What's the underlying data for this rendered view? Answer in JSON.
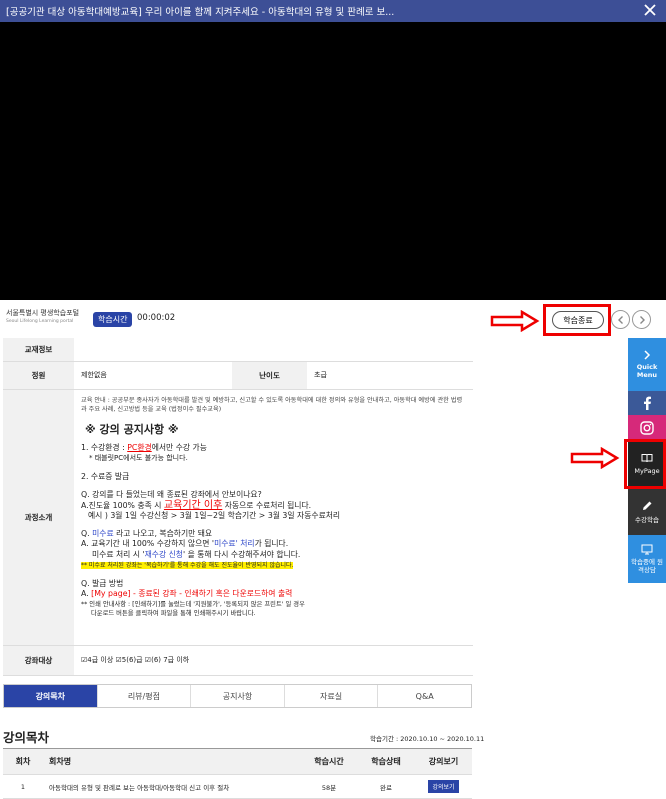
{
  "window": {
    "title": "[공공기관 대상 아동학대예방교육] 우리 아이를 함께 지켜주세요 - 아동학대의 유형 및 판례로 보..."
  },
  "toolbar": {
    "logo_korean": "서울특별시 평생학습포털",
    "logo_english": "Seoul Lifelong Learning portal",
    "timer_label": "학습시간",
    "timer_value": "00:00:02",
    "end_label": "학습종료"
  },
  "info": {
    "material_label": "교재정보",
    "capacity_label": "정원",
    "capacity_value": "제한없음",
    "difficulty_label": "난이도",
    "difficulty_value": "초급",
    "intro_label": "과정소개",
    "intro_text": "교육 안내 : 공공부문 종사자가 아동학대를 발견 및 예방하고, 신고할 수 있도록 아동학대에 대한 정의와 유형을 안내하고, 아동학대 예방에 관한 법령과 주요 사례, 신고방법 등을 교육 (법정이수 필수교육)",
    "notice_title": "※ 강의 공지사항 ※",
    "l1a": "1. 수강환경 : ",
    "l1b": "PC환경",
    "l1c": "에서만 수강 가능",
    "l1d": "* 태블릿PC에서도 불가능 합니다.",
    "l2": "2. 수료증 발급",
    "q1": "Q. 강의를 다 들었는데 왜 종료된 강좌에서 안보이나요?",
    "a1a": "A.진도율 100% 충족 시 ",
    "a1b": "교육기간 이후",
    "a1c": " 자동으로 수료처리 됩니다.",
    "a1d": "예시 ) 3월 1일 수강신청 > 3월 1일~2일 학습기간 > 3월 3일 자동수료처리",
    "q2a": "Q. ",
    "q2b": "미수료",
    "q2c": " 라고 나오고, 복습하기만 돼요",
    "a2a": "A. 교육기간 내 100% 수강하지 않으면 '",
    "a2b": "미수료' 처리",
    "a2c": "가 됩니다.",
    "a2d": "미수료 처리 시 '",
    "a2e": "재수강 신청",
    "a2f": "' 을 통해 다시 수강해주셔야 합니다.",
    "hl": "** 미수료 처리된 강좌는 '복습하기'를 통해 수강을 해도 진도율이 반영되지 않습니다.",
    "q3": "Q. 발급 방법",
    "a3a": "A. ",
    "a3b": "[My page]",
    "a3c": " - 종료된 강좌 - 인쇄하기 혹은 다운로드하여 출력",
    "a3d": "** 인쇄 안내사항 : [인쇄하기]를 눌렀는데 '지원불가', '등록되지 않은 프린트' 일 경우",
    "a3e": "다운로드 버튼을 클릭하여 파일을 통해 인쇄해주시기 바랍니다.",
    "target_label": "강좌대상",
    "target_value": "☑4급 이상 ☑5(6)급 ☑(6) 7급 이하"
  },
  "sidebar": {
    "quick_menu": "Quick Menu",
    "mypage": "MyPage",
    "study": "수강학습",
    "remote": "학습중에 원격상담"
  },
  "tabs": [
    "강의목차",
    "리뷰/평점",
    "공지사항",
    "자료실",
    "Q&A"
  ],
  "lecture": {
    "title": "강의목차",
    "period": "학습기간 : 2020.10.10 ~ 2020.10.11",
    "headers": [
      "회차",
      "회차명",
      "학습시간",
      "학습상태",
      "강의보기"
    ],
    "row": {
      "no": "1",
      "name": "아동학대의 유형 및 판례로 보는 아동학대/아동학대 신고 이후 절차",
      "time": "58분",
      "status": "완료",
      "view": "강의보기"
    }
  },
  "colors": {
    "accent": "#2a44a6",
    "topbar": "#3d4f96",
    "highlight_red": "#e00000"
  }
}
